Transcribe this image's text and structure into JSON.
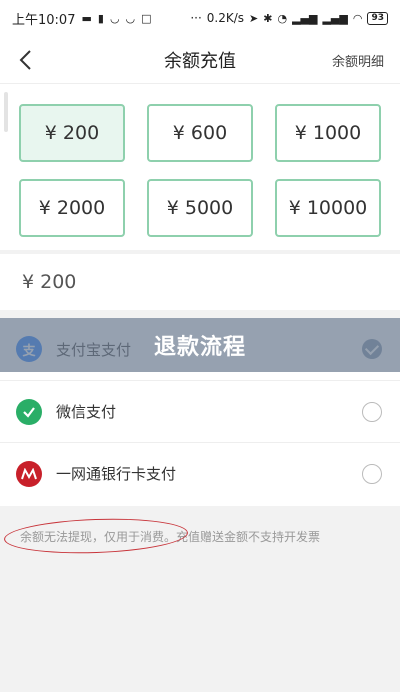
{
  "status_bar": {
    "time": "上午10:07",
    "network_speed": "0.2K/s",
    "battery": "93",
    "more": "···"
  },
  "nav": {
    "title": "余额充值",
    "right_link": "余额明细"
  },
  "amounts": [
    {
      "label": "¥ 200",
      "selected": true
    },
    {
      "label": "¥ 600",
      "selected": false
    },
    {
      "label": "¥ 1000",
      "selected": false
    },
    {
      "label": "¥ 2000",
      "selected": false
    },
    {
      "label": "¥ 5000",
      "selected": false
    },
    {
      "label": "¥ 10000",
      "selected": false
    }
  ],
  "custom_amount_value": "¥ 200",
  "overlay_banner": "退款流程",
  "payment_methods": [
    {
      "label": "支付宝支付",
      "icon": "alipay-icon",
      "icon_glyph": "支",
      "color": "#1677ff",
      "checked": true
    },
    {
      "label": "微信支付",
      "icon": "wechat-pay-icon",
      "icon_glyph": "",
      "color": "#2aae67",
      "checked": false
    },
    {
      "label": "一网通银行卡支付",
      "icon": "bank-card-icon",
      "icon_glyph": "",
      "color": "#c8202a",
      "checked": false
    }
  ],
  "notice": "余额无法提现，仅用于消费。充值赠送金额不支持开发票",
  "colors": {
    "accent_border": "#8ed0ad",
    "selected_bg": "#e8f6ef",
    "annotation_red": "#c8343a"
  }
}
